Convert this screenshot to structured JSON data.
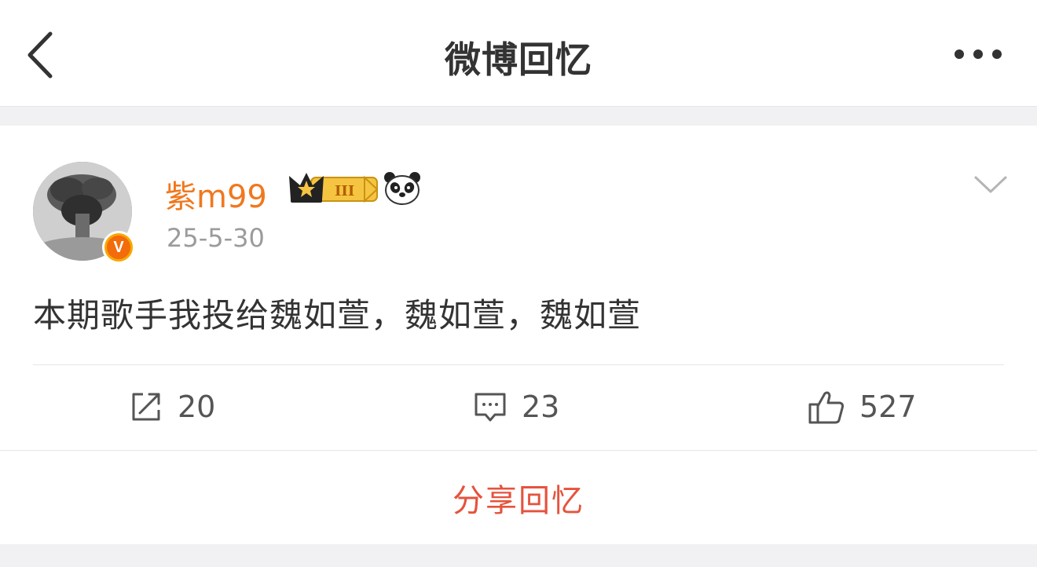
{
  "header": {
    "title": "微博回忆",
    "back_icon": "chevron-left-icon",
    "more_icon": "more-dots-icon"
  },
  "post": {
    "author": {
      "name": "紫m99",
      "verified_badge": "V",
      "member_level": "III"
    },
    "timestamp": "25-5-30",
    "text": "本期歌手我投给魏如萱，魏如萱，魏如萱",
    "actions": {
      "reposts": "20",
      "comments": "23",
      "likes": "527"
    }
  },
  "share_button": "分享回忆",
  "colors": {
    "username": "#f0781e",
    "share": "#e5533d",
    "background": "#f1f1f3"
  }
}
